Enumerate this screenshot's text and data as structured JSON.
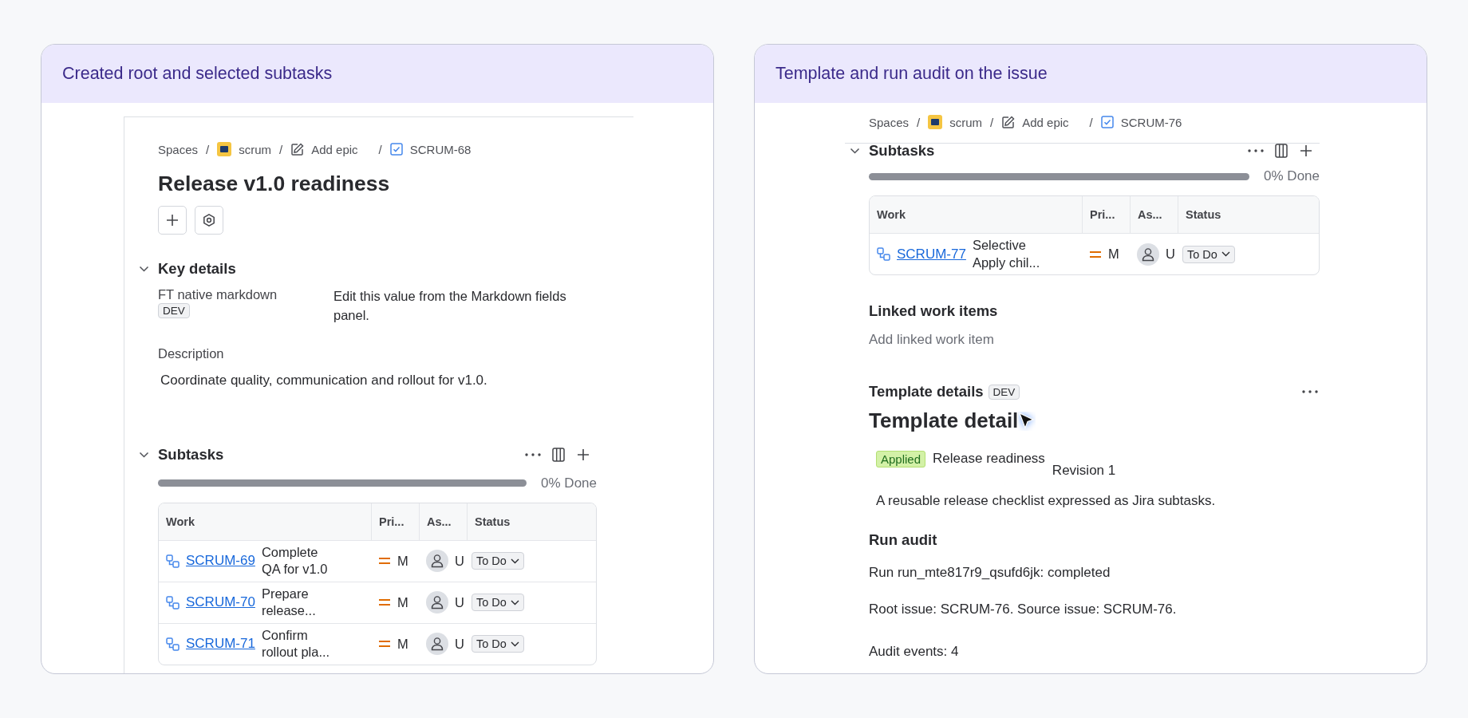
{
  "panels": [
    {
      "title": "Created root and selected subtasks",
      "breadcrumb": [
        {
          "kind": "text",
          "label": "Spaces",
          "separator": "/"
        },
        {
          "kind": "project",
          "label": "scrum",
          "separator": "/"
        },
        {
          "kind": "epic",
          "label": "Add epic",
          "separator": "/"
        },
        {
          "kind": "issue",
          "label": "SCRUM-68"
        }
      ],
      "sections": [
        {
          "kind": "issue-header",
          "title": "Release v1.0 readiness"
        },
        {
          "kind": "key-details",
          "heading": "Key details",
          "expanded": true,
          "field_label": "FT native markdown",
          "field_badge": "DEV",
          "field_value": "Edit this value from the Markdown fields panel.",
          "description_label": "Description",
          "description": "Coordinate quality, communication and rollout for v1.0."
        },
        {
          "kind": "subtasks",
          "heading": "Subtasks",
          "expanded": true,
          "progress": {
            "level": 0,
            "reading": "0% Done"
          },
          "columns": [
            "Work",
            "Pri...",
            "As...",
            "Status"
          ],
          "rows": [
            {
              "key": "SCRUM-69",
              "summary": "Complete QA for v1.0",
              "priority": "M",
              "assignee": "U",
              "status": "To Do"
            },
            {
              "key": "SCRUM-70",
              "summary": "Prepare release...",
              "priority": "M",
              "assignee": "U",
              "status": "To Do"
            },
            {
              "key": "SCRUM-71",
              "summary": "Confirm rollout pla...",
              "priority": "M",
              "assignee": "U",
              "status": "To Do"
            }
          ]
        }
      ]
    },
    {
      "title": "Template and run audit on the issue",
      "breadcrumb": [
        {
          "kind": "text",
          "label": "Spaces",
          "separator": "/"
        },
        {
          "kind": "project",
          "label": "scrum",
          "separator": "/"
        },
        {
          "kind": "epic",
          "label": "Add epic",
          "separator": "/"
        },
        {
          "kind": "issue",
          "label": "SCRUM-76"
        }
      ],
      "sections": [
        {
          "kind": "subtasks",
          "heading": "Subtasks",
          "expanded": true,
          "progress": {
            "level": 0,
            "reading": "0% Done"
          },
          "columns": [
            "Work",
            "Pri...",
            "As...",
            "Status"
          ],
          "rows": [
            {
              "key": "SCRUM-77",
              "summary": "Selective Apply chil...",
              "priority": "M",
              "assignee": "U",
              "status": "To Do"
            }
          ]
        },
        {
          "kind": "linked",
          "heading": "Linked work items",
          "action": "Add linked work item"
        },
        {
          "kind": "template",
          "heading": "Template details",
          "badge": "DEV",
          "title": "Template detail",
          "status": "Applied",
          "name": "Release readiness",
          "revision": "Revision 1",
          "description": "A reusable release checklist expressed as Jira subtasks."
        },
        {
          "kind": "audit",
          "heading": "Run audit",
          "lines": [
            "Run run_mte817r9_qsufd6jk: completed",
            "Root issue: SCRUM-76. Source issue: SCRUM-76.",
            "Audit events: 4"
          ]
        }
      ]
    }
  ]
}
